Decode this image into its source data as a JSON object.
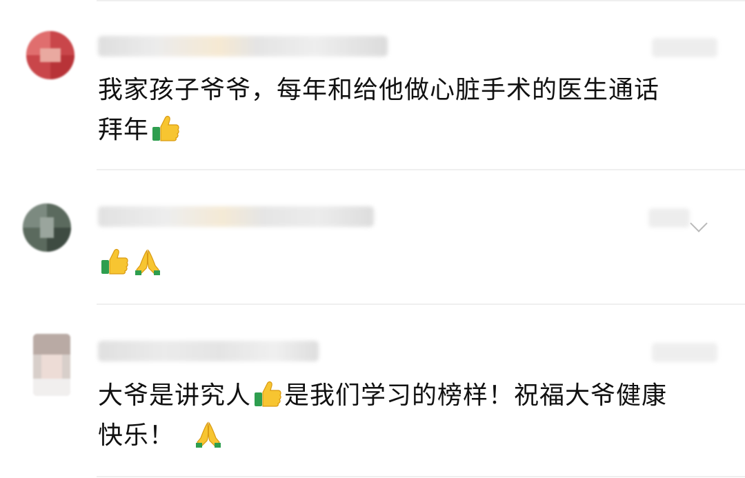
{
  "comments": [
    {
      "text_line1": "我家孩子爷爷，每年和给他做心脏手术的医生通话",
      "text_line2": "拜年",
      "emojis": [
        "thumbs-up"
      ]
    },
    {
      "emojis": [
        "thumbs-up",
        "folded-hands"
      ]
    },
    {
      "text_line1a": "大爷是讲究人",
      "text_line1b": "是我们学习的榜样！祝福大爷健康",
      "text_line2": "快乐！",
      "emojis": [
        "thumbs-up",
        "folded-hands"
      ]
    }
  ],
  "icons": {
    "thumbs_up": "thumbs-up-icon",
    "folded_hands": "folded-hands-icon",
    "more": "chevron-down-icon"
  },
  "colors": {
    "text": "#111111",
    "divider": "#efefef",
    "emoji_yellow": "#f7c531",
    "emoji_green": "#2e9e4f"
  }
}
